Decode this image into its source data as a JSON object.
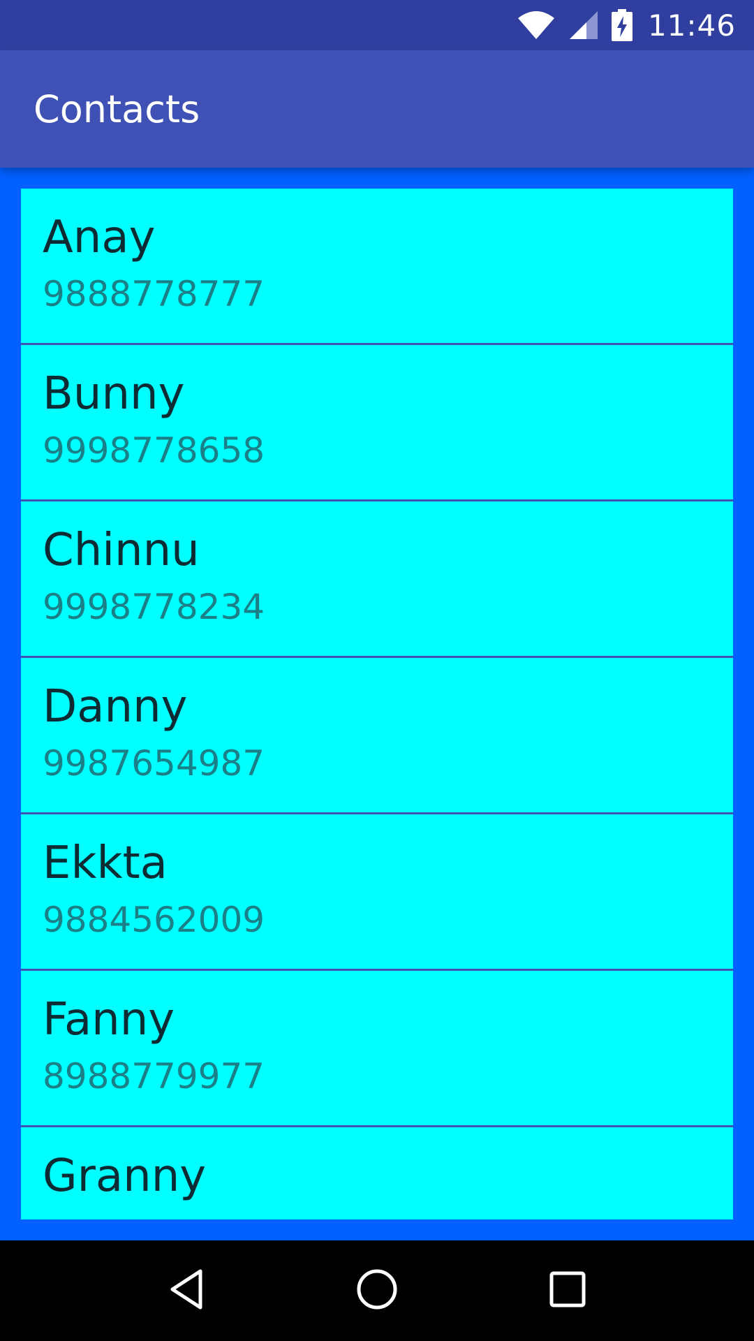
{
  "status_bar": {
    "time": "11:46",
    "icons": [
      "wifi-icon",
      "signal-icon",
      "battery-charging-icon"
    ]
  },
  "app_bar": {
    "title": "Contacts"
  },
  "contacts": [
    {
      "name": "Anay",
      "phone": "9888778777"
    },
    {
      "name": "Bunny",
      "phone": "9998778658"
    },
    {
      "name": "Chinnu",
      "phone": "9998778234"
    },
    {
      "name": "Danny",
      "phone": "9987654987"
    },
    {
      "name": "Ekkta",
      "phone": "9884562009"
    },
    {
      "name": "Fanny",
      "phone": "8988779977"
    },
    {
      "name": "Granny",
      "phone": ""
    }
  ],
  "nav_bar": {
    "icons": [
      "back-icon",
      "home-icon",
      "recents-icon"
    ]
  },
  "colors": {
    "status_bar": "#303f9f",
    "app_bar": "#3f51b5",
    "background": "#0060ff",
    "item_background": "#00ffff",
    "divider": "#3f51b5"
  }
}
